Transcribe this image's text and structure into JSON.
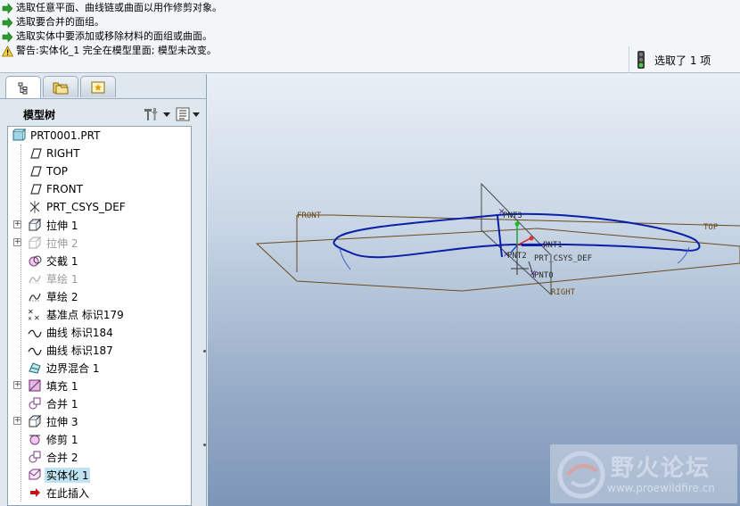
{
  "messages": [
    {
      "type": "info",
      "text": "选取任意平面、曲线链或曲面以用作修剪对象。"
    },
    {
      "type": "info",
      "text": "选取要合并的面组。"
    },
    {
      "type": "info",
      "text": "选取实体中要添加或移除材料的面组或曲面。"
    },
    {
      "type": "warning",
      "text": "警告:实体化_1 完全在模型里面; 模型未改变。"
    }
  ],
  "status": {
    "selected_text": "选取了 1 项"
  },
  "panel": {
    "title": "模型树"
  },
  "tree": {
    "root": "PRT0001.PRT",
    "items": [
      {
        "label": "RIGHT",
        "icon": "datum-plane-icon",
        "expand": false,
        "dim": false,
        "sel": false
      },
      {
        "label": "TOP",
        "icon": "datum-plane-icon",
        "expand": false,
        "dim": false,
        "sel": false
      },
      {
        "label": "FRONT",
        "icon": "datum-plane-icon",
        "expand": false,
        "dim": false,
        "sel": false
      },
      {
        "label": "PRT_CSYS_DEF",
        "icon": "csys-icon",
        "expand": false,
        "dim": false,
        "sel": false
      },
      {
        "label": "拉伸 1",
        "icon": "extrude-icon",
        "expand": true,
        "dim": false,
        "sel": false
      },
      {
        "label": "拉伸 2",
        "icon": "extrude-icon",
        "expand": true,
        "dim": true,
        "sel": false
      },
      {
        "label": "交截 1",
        "icon": "intersect-icon",
        "expand": false,
        "dim": false,
        "sel": false
      },
      {
        "label": "草绘 1",
        "icon": "sketch-icon",
        "expand": false,
        "dim": true,
        "sel": false
      },
      {
        "label": "草绘 2",
        "icon": "sketch-icon",
        "expand": false,
        "dim": false,
        "sel": false
      },
      {
        "label": "基准点 标识179",
        "icon": "datum-point-icon",
        "expand": false,
        "dim": false,
        "sel": false
      },
      {
        "label": "曲线 标识184",
        "icon": "curve-icon",
        "expand": false,
        "dim": false,
        "sel": false
      },
      {
        "label": "曲线 标识187",
        "icon": "curve-icon",
        "expand": false,
        "dim": false,
        "sel": false
      },
      {
        "label": "边界混合 1",
        "icon": "boundary-blend-icon",
        "expand": false,
        "dim": false,
        "sel": false
      },
      {
        "label": "填充 1",
        "icon": "fill-icon",
        "expand": true,
        "dim": false,
        "sel": false
      },
      {
        "label": "合并 1",
        "icon": "merge-icon",
        "expand": false,
        "dim": false,
        "sel": false
      },
      {
        "label": "拉伸 3",
        "icon": "extrude-icon",
        "expand": true,
        "dim": false,
        "sel": false
      },
      {
        "label": "修剪 1",
        "icon": "trim-icon",
        "expand": false,
        "dim": false,
        "sel": false
      },
      {
        "label": "合并 2",
        "icon": "merge-icon",
        "expand": false,
        "dim": false,
        "sel": false
      },
      {
        "label": "实体化 1",
        "icon": "solidify-icon",
        "expand": false,
        "dim": false,
        "sel": true
      },
      {
        "label": "在此插入",
        "icon": "insert-here-icon",
        "expand": false,
        "dim": false,
        "sel": false
      }
    ]
  },
  "viewport": {
    "labels": {
      "front": "FRONT",
      "top": "TOP",
      "right": "RIGHT",
      "csys": "PRT_CSYS_DEF",
      "pnt0": "PNT0",
      "pnt1": "PNT1",
      "pnt2": "PNT2",
      "pnt3": "PNT3"
    }
  },
  "watermark": {
    "title": "野火论坛",
    "url": "www.proewildfire.cn"
  },
  "colors": {
    "curve": "#0a1ea8",
    "plane": "#6b4a1e",
    "selected": "#bfe3f0"
  }
}
